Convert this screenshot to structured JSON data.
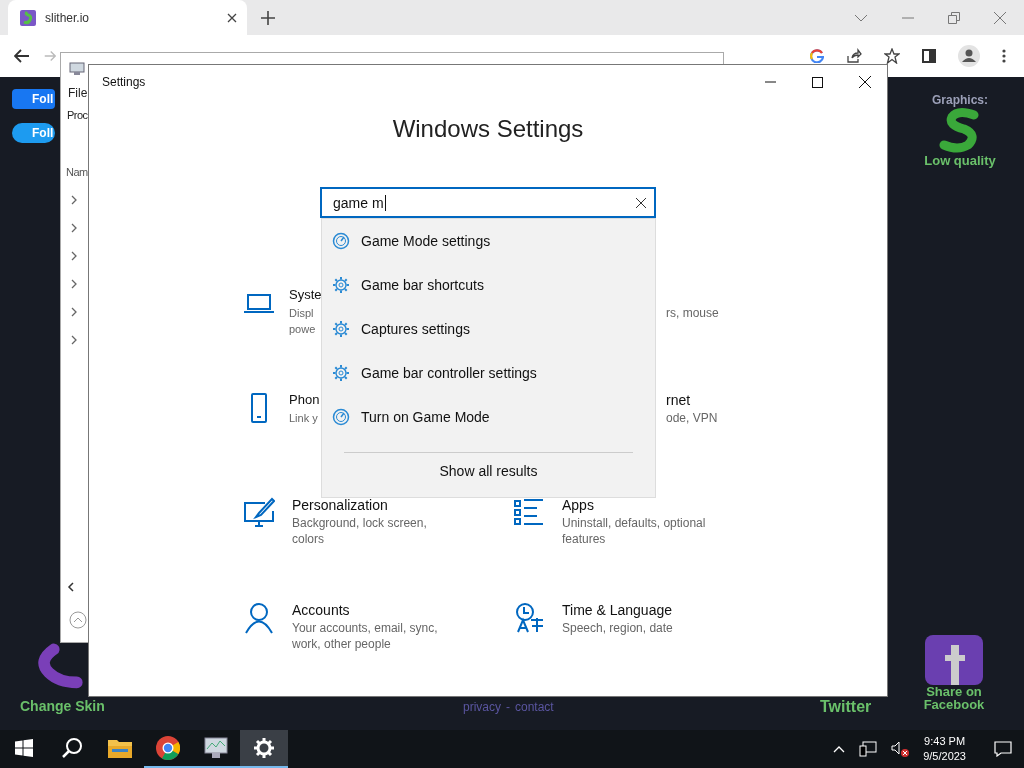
{
  "browser": {
    "tab": {
      "title": "slither.io"
    }
  },
  "page": {
    "facebook_follow": "Foll",
    "twitter_follow": "Foll",
    "graphics_label": "Graphics:",
    "graphics_value": "Low quality",
    "change_skin": "Change Skin",
    "footer_links": [
      "privacy",
      "contact"
    ],
    "footer_separator": "-",
    "twitter_share": "Twitter",
    "facebook_share": "Share on Facebook"
  },
  "background_window": {
    "menu": "File",
    "tab": "Proc",
    "column": "Nam",
    "rows": [
      {
        "expanded": false
      },
      {
        "expanded": false
      },
      {
        "expanded": false
      },
      {
        "expanded": false
      },
      {
        "expanded": false
      },
      {
        "expanded": false
      }
    ]
  },
  "settings": {
    "title": "Settings",
    "heading": "Windows Settings",
    "search": {
      "value": "game m"
    },
    "suggestions": [
      {
        "label": "Game Mode settings",
        "kind": "gauge"
      },
      {
        "label": "Game bar shortcuts",
        "kind": "gear"
      },
      {
        "label": "Captures settings",
        "kind": "gear"
      },
      {
        "label": "Game bar controller settings",
        "kind": "gear"
      },
      {
        "label": "Turn on Game Mode",
        "kind": "gauge"
      }
    ],
    "show_all": "Show all results",
    "tiles": [
      {
        "kind": "partial_left",
        "title": "Syste",
        "description": "Displ powe"
      },
      {
        "kind": "partial_right",
        "description": "rs, mouse"
      },
      {
        "kind": "partial_left",
        "title": "Phon",
        "description": "Link y"
      },
      {
        "kind": "partial_right",
        "title": "rnet",
        "description": "ode, VPN"
      },
      {
        "kind": "full",
        "title": "Personalization",
        "description": "Background, lock screen, colors"
      },
      {
        "kind": "full",
        "title": "Apps",
        "description": "Uninstall, defaults, optional features"
      },
      {
        "kind": "full",
        "title": "Accounts",
        "description": "Your accounts, email, sync, work, other people"
      },
      {
        "kind": "full",
        "title": "Time & Language",
        "description": "Speech, region, date"
      }
    ]
  },
  "taskbar": {
    "apps": [
      {
        "kind": "start",
        "running": false,
        "active": false
      },
      {
        "kind": "search",
        "running": false,
        "active": false
      },
      {
        "kind": "folder",
        "running": false,
        "active": false
      },
      {
        "kind": "browser",
        "running": true,
        "active": false
      },
      {
        "kind": "monitor",
        "running": true,
        "active": false
      },
      {
        "kind": "settings",
        "running": true,
        "active": true
      }
    ],
    "time": "9:43 PM",
    "date": "9/5/2023"
  }
}
